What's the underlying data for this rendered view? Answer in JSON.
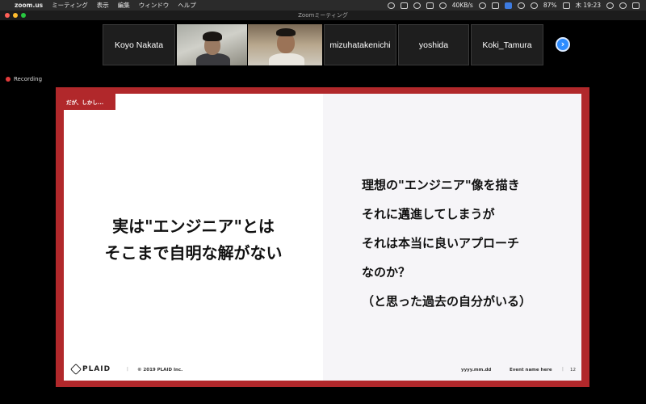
{
  "menubar": {
    "app": "zoom.us",
    "items": [
      "ミーティング",
      "表示",
      "編集",
      "ウィンドウ",
      "ヘルプ"
    ],
    "network": "40KB/s",
    "battery": "87%",
    "clock": "木 19:23"
  },
  "window": {
    "title": "Zoomミーティング"
  },
  "participants": [
    {
      "name": "Koyo Nakata"
    },
    {
      "name": "mizuhatakenichi"
    },
    {
      "name": "yoshida"
    },
    {
      "name": "Koki_Tamura"
    }
  ],
  "next_icon": "›",
  "recording": {
    "label": "Recording"
  },
  "slide": {
    "tag": "だが、しかし...",
    "main_lines": [
      "実は\"エンジニア\"とは",
      "そこまで自明な解がない"
    ],
    "right_lines": [
      "理想の\"エンジニア\"像を描き",
      "それに邁進してしまうが",
      "それは本当に良いアプローチ",
      "なのか？",
      "（と思った過去の自分がいる）"
    ],
    "footer": {
      "logo": "PLAID",
      "separator": "|",
      "copyright": "© 2019 PLAID Inc.",
      "date": "yyyy.mm.dd",
      "event": "Event name here",
      "page": "12"
    }
  },
  "colors": {
    "slide_red": "#b1282b",
    "zoom_blue": "#2d8cff",
    "recording_red": "#e23b3b"
  }
}
